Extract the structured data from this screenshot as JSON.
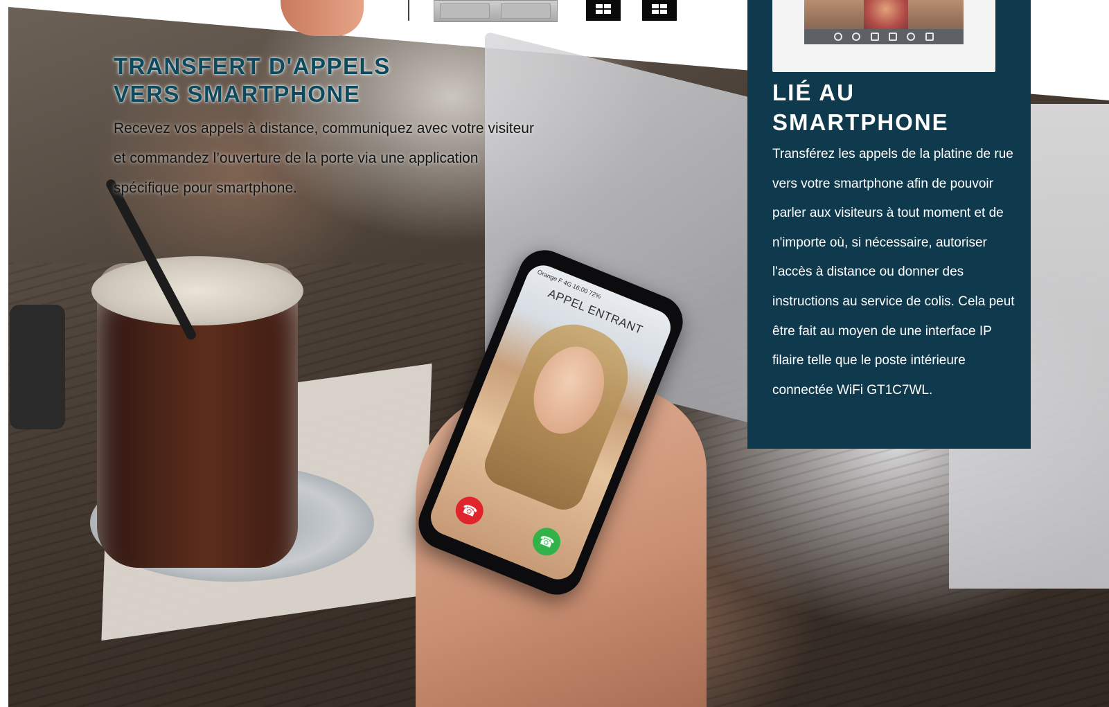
{
  "left": {
    "title_lines": [
      "TRANSFERT D'APPELS",
      "VERS SMARTPHONE"
    ],
    "body": "Recevez vos appels à distance, communiquez avec votre visiteur et commandez l’ouverture de la porte via une application spécifique pour smartphone."
  },
  "phone": {
    "screen_title": "APPEL ENTRANT",
    "status": "Orange F  4G      16:00      72%"
  },
  "panel": {
    "title_lines": [
      "LIÉ AU",
      "SMARTPHONE"
    ],
    "body": "Transférez les appels de la platine de rue vers votre smartphone afin de pouvoir parler aux visiteurs à tout moment et de n'importe où, si nécessaire, autoriser l'accès à distance ou donner des instructions au service de colis. Cela peut être fait au moyen de une interface IP filaire telle que le poste intérieure connectée WiFi GT1C7WL.",
    "accent_color": "#0f3a4d"
  },
  "colors": {
    "title_teal": "#0e4a5d",
    "panel_bg": "#0f3a4d",
    "decline_red": "#e0242b",
    "accept_green": "#32b34a"
  },
  "icons": [
    "qr-code-icon",
    "qr-code-icon",
    "lock-icon",
    "key-icon",
    "camera-icon",
    "speaker-icon",
    "hang-up-icon",
    "answer-icon"
  ]
}
